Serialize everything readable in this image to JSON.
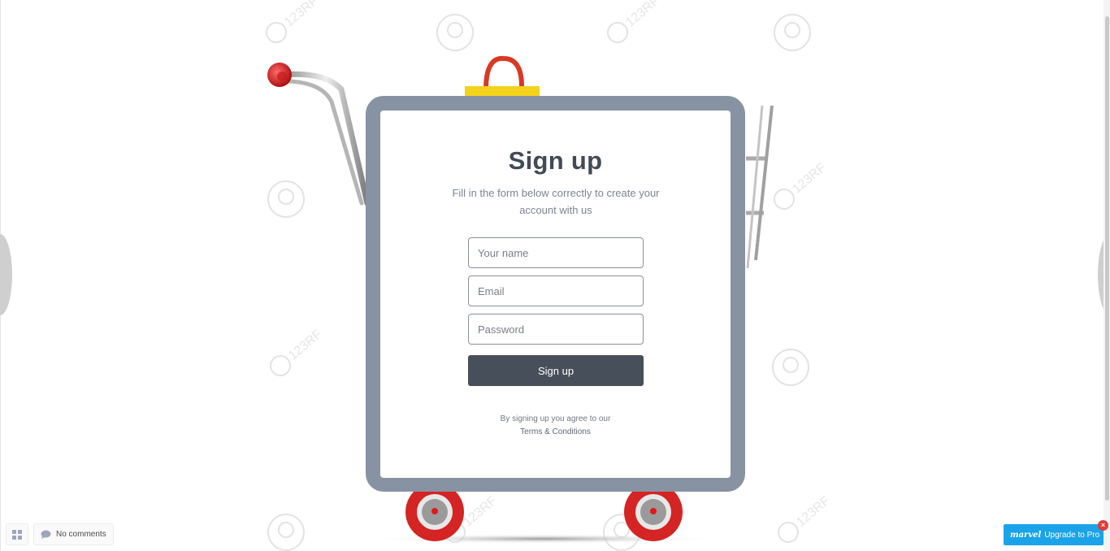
{
  "signup": {
    "title": "Sign up",
    "subtitle": "Fill in the form below correctly to create your account with us",
    "name_placeholder": "Your name",
    "email_placeholder": "Email",
    "password_placeholder": "Password",
    "submit_label": "Sign up",
    "terms_prefix": "By signing up you agree to our",
    "terms_link": "Terms & Conditions"
  },
  "toolbar": {
    "comments_label": "No comments"
  },
  "upgrade": {
    "logo_text": "marvel",
    "label": "Upgrade to Pro",
    "close_glyph": "×"
  },
  "watermark": {
    "text": "123RF"
  },
  "colors": {
    "frame": "#8793a3",
    "button": "#474f5a",
    "upgrade": "#1aa3e8",
    "cart_red": "#d62828"
  }
}
